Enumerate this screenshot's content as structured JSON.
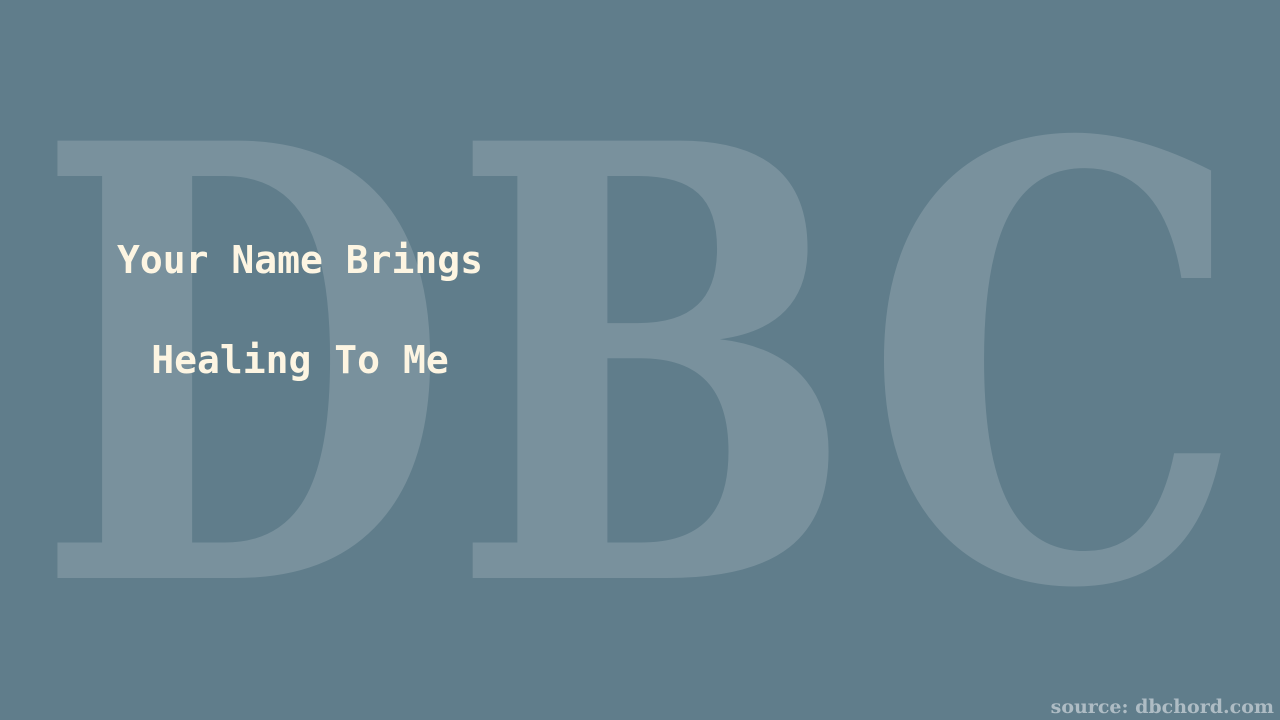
{
  "watermark": {
    "text": "DBC"
  },
  "title": {
    "line1": "Your Name Brings",
    "line2": "Healing To Me"
  },
  "source": {
    "text": "source: dbchord.com"
  },
  "colors": {
    "background": "#607d8b",
    "title_text": "#fdf5e2",
    "source_text": "#aebcc4"
  }
}
